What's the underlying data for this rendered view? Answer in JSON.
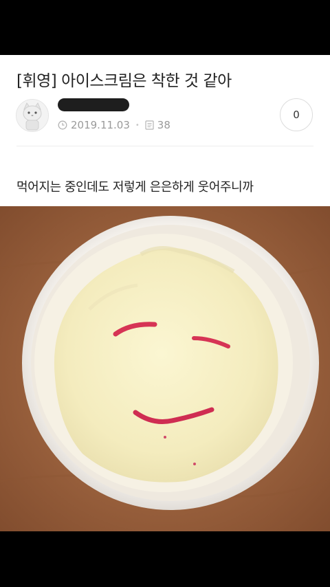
{
  "post": {
    "title": "[휘영] 아이스크림은 착한 것 같아",
    "date": "2019.11.03",
    "views": "38",
    "comments": "0",
    "body": "먹어지는 중인데도 저렇게 은은하게 웃어주니까"
  },
  "icons": {
    "avatar": "cat-avatar-icon",
    "date": "clock-icon",
    "views": "document-icon"
  },
  "colors": {
    "page_background": "#000000",
    "card_background": "#ffffff",
    "meta_text": "#9a9a9a",
    "title_text": "#222222"
  }
}
